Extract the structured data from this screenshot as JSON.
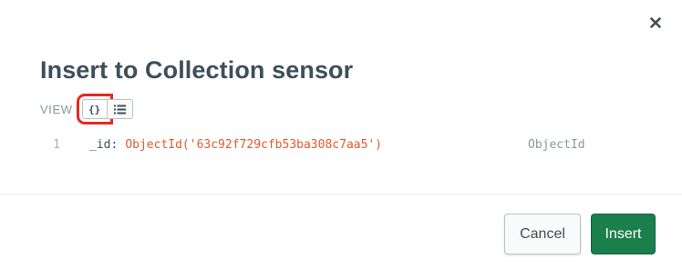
{
  "dialog": {
    "title": "Insert to Collection sensor",
    "close_icon": "close-icon"
  },
  "view": {
    "label": "VIEW",
    "json_toggle_label": "{}",
    "list_toggle_icon": "list-icon",
    "selected": "json"
  },
  "editor": {
    "lines": [
      {
        "number": "1",
        "key": "_id",
        "value": "ObjectId('63c92f729cfb53ba308c7aa5')",
        "type": "ObjectId"
      }
    ]
  },
  "footer": {
    "cancel_label": "Cancel",
    "insert_label": "Insert"
  },
  "colors": {
    "title": "#3d4f58",
    "value": "#e6592c",
    "insert_button": "#1a7f4b",
    "highlight": "#e8281f"
  }
}
